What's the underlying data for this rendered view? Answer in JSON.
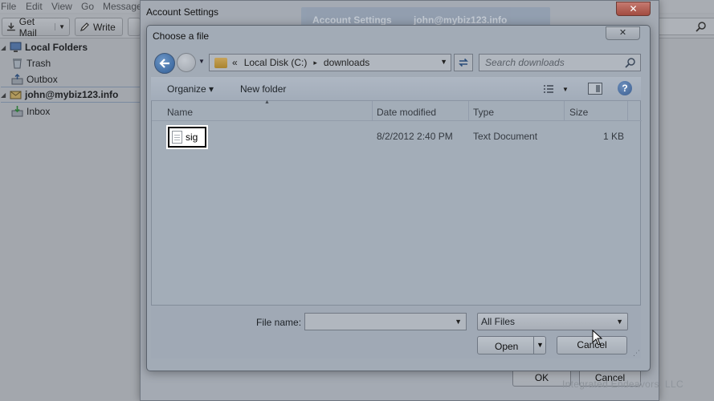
{
  "background_app": {
    "menu": [
      "File",
      "Edit",
      "View",
      "Go",
      "Message"
    ],
    "toolbar": {
      "get_mail_label": "Get Mail",
      "write_label": "Write"
    },
    "folder_tree": [
      {
        "label": "Local Folders",
        "bold": true
      },
      {
        "label": "Trash",
        "bold": false
      },
      {
        "label": "Outbox",
        "bold": false
      },
      {
        "label": "john@mybiz123.info",
        "bold": true
      },
      {
        "label": "Inbox",
        "bold": false
      }
    ]
  },
  "account_settings": {
    "title": "Account Settings",
    "close_label": "✕",
    "ok_label": "OK",
    "cancel_label": "Cancel",
    "ghost_heading": "Account Settings",
    "ghost_email": "john@mybiz123.info",
    "watermark": "Integrated Endeavors, LLC"
  },
  "file_dialog": {
    "title": "Choose a file",
    "close_label": "✕",
    "address": {
      "prefix": "«",
      "location": "Local Disk (C:)",
      "separator": "▸",
      "folder": "downloads"
    },
    "search_placeholder": "Search downloads",
    "commands": {
      "organize_label": "Organize ▾",
      "new_folder_label": "New folder",
      "help_label": "?"
    },
    "columns": {
      "name": "Name",
      "date_modified": "Date modified",
      "type": "Type",
      "size": "Size"
    },
    "files": [
      {
        "name": "sig",
        "date_modified": "8/2/2012 2:40 PM",
        "type": "Text Document",
        "size": "1 KB"
      }
    ],
    "file_name_label": "File name:",
    "file_name_value": "",
    "file_type_selected": "All Files",
    "open_label": "Open",
    "cancel_label": "Cancel"
  }
}
